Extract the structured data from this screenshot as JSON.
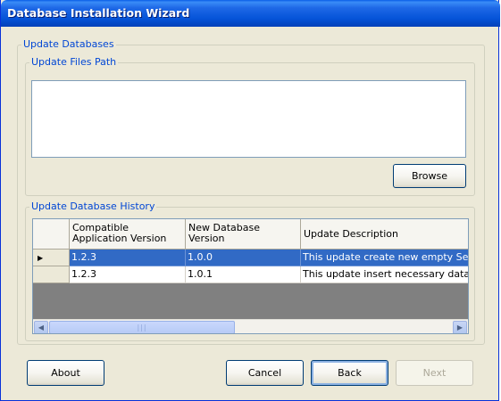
{
  "window": {
    "title": "Database Installation Wizard"
  },
  "update_databases": {
    "legend": "Update Databases",
    "files_path": {
      "legend": "Update Files Path",
      "value": "",
      "browse_label": "Browse"
    },
    "history": {
      "legend": "Update Database History",
      "columns": [
        "Compatible\nApplication Version",
        "New Database\nVersion",
        "Update Description"
      ],
      "rows": [
        {
          "compatible_version": "1.2.3",
          "new_version": "1.0.0",
          "description": "This update create new empty Security",
          "selected": true
        },
        {
          "compatible_version": "1.2.3",
          "new_version": "1.0.1",
          "description": "This update insert necessary data into S",
          "selected": false
        }
      ],
      "scroll_grip": "|||"
    }
  },
  "buttons": {
    "about": "About",
    "cancel": "Cancel",
    "back": "Back",
    "next": "Next"
  },
  "icons": {
    "row_pointer": "▶",
    "scroll_left": "◀",
    "scroll_right": "▶"
  }
}
